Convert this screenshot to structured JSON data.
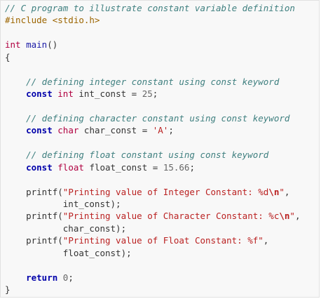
{
  "colors": {
    "background": "#f8f8f8",
    "text": "#333333",
    "comment": "#408080",
    "preprocessor": "#9c6500",
    "keyword": "#0000aa",
    "type": "#b00040",
    "string": "#ba2121",
    "number": "#666666"
  },
  "code": {
    "language": "C",
    "lines": [
      [
        {
          "t": "// C program to illustrate constant variable definition",
          "k": "comment"
        }
      ],
      [
        {
          "t": "#include <stdio.h>",
          "k": "preproc"
        }
      ],
      [],
      [
        {
          "t": "int",
          "k": "type"
        },
        {
          "t": " main",
          "k": "func"
        },
        {
          "t": "()",
          "k": "punct"
        }
      ],
      [
        {
          "t": "{",
          "k": "punct"
        }
      ],
      [],
      [
        {
          "t": "    ",
          "k": "indent"
        },
        {
          "t": "// defining integer constant using const keyword",
          "k": "comment"
        }
      ],
      [
        {
          "t": "    ",
          "k": "indent"
        },
        {
          "t": "const",
          "k": "keyword"
        },
        {
          "t": " ",
          "k": "punct"
        },
        {
          "t": "int",
          "k": "type"
        },
        {
          "t": " int_const = ",
          "k": "ident"
        },
        {
          "t": "25",
          "k": "number"
        },
        {
          "t": ";",
          "k": "punct"
        }
      ],
      [],
      [
        {
          "t": "    ",
          "k": "indent"
        },
        {
          "t": "// defining character constant using const keyword",
          "k": "comment"
        }
      ],
      [
        {
          "t": "    ",
          "k": "indent"
        },
        {
          "t": "const",
          "k": "keyword"
        },
        {
          "t": " ",
          "k": "punct"
        },
        {
          "t": "char",
          "k": "type"
        },
        {
          "t": " char_const = ",
          "k": "ident"
        },
        {
          "t": "'A'",
          "k": "string"
        },
        {
          "t": ";",
          "k": "punct"
        }
      ],
      [],
      [
        {
          "t": "    ",
          "k": "indent"
        },
        {
          "t": "// defining float constant using const keyword",
          "k": "comment"
        }
      ],
      [
        {
          "t": "    ",
          "k": "indent"
        },
        {
          "t": "const",
          "k": "keyword"
        },
        {
          "t": " ",
          "k": "punct"
        },
        {
          "t": "float",
          "k": "type"
        },
        {
          "t": " float_const = ",
          "k": "ident"
        },
        {
          "t": "15.66",
          "k": "number"
        },
        {
          "t": ";",
          "k": "punct"
        }
      ],
      [],
      [
        {
          "t": "    printf(",
          "k": "ident"
        },
        {
          "t": "\"Printing value of Integer Constant: %d",
          "k": "string"
        },
        {
          "t": "\\n",
          "k": "escape"
        },
        {
          "t": "\"",
          "k": "string"
        },
        {
          "t": ",",
          "k": "punct"
        }
      ],
      [
        {
          "t": "           int_const);",
          "k": "ident"
        }
      ],
      [
        {
          "t": "    printf(",
          "k": "ident"
        },
        {
          "t": "\"Printing value of Character Constant: %c",
          "k": "string"
        },
        {
          "t": "\\n",
          "k": "escape"
        },
        {
          "t": "\"",
          "k": "string"
        },
        {
          "t": ",",
          "k": "punct"
        }
      ],
      [
        {
          "t": "           char_const);",
          "k": "ident"
        }
      ],
      [
        {
          "t": "    printf(",
          "k": "ident"
        },
        {
          "t": "\"Printing value of Float Constant: %f\"",
          "k": "string"
        },
        {
          "t": ",",
          "k": "punct"
        }
      ],
      [
        {
          "t": "           float_const);",
          "k": "ident"
        }
      ],
      [],
      [
        {
          "t": "    ",
          "k": "indent"
        },
        {
          "t": "return",
          "k": "keyword"
        },
        {
          "t": " ",
          "k": "punct"
        },
        {
          "t": "0",
          "k": "number"
        },
        {
          "t": ";",
          "k": "punct"
        }
      ],
      [
        {
          "t": "}",
          "k": "punct"
        }
      ]
    ]
  }
}
